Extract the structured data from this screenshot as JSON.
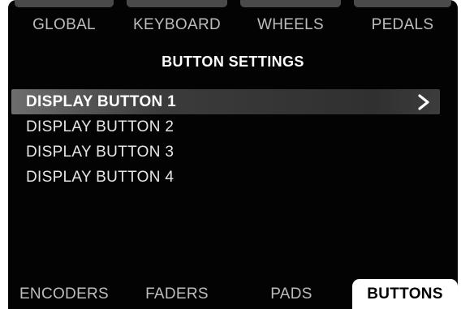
{
  "top_tabs": [
    {
      "label": "GLOBAL"
    },
    {
      "label": "KEYBOARD"
    },
    {
      "label": "WHEELS"
    },
    {
      "label": "PEDALS"
    }
  ],
  "title": "BUTTON SETTINGS",
  "list": {
    "selected_index": 0,
    "items": [
      {
        "label": "DISPLAY BUTTON 1"
      },
      {
        "label": "DISPLAY BUTTON 2"
      },
      {
        "label": "DISPLAY BUTTON 3"
      },
      {
        "label": "DISPLAY BUTTON 4"
      }
    ],
    "selected_icon": "chevron-right-icon"
  },
  "bottom_tabs": [
    {
      "label": "ENCODERS"
    },
    {
      "label": "FADERS"
    },
    {
      "label": "PADS"
    },
    {
      "label": "BUTTONS"
    }
  ],
  "active_bottom_tab": "BUTTONS",
  "colors": {
    "screen_background": "#030303",
    "text": "#e6e6e6",
    "inactive_tab_text": "#bdbdbd",
    "active_tab_background": "#ffffff",
    "active_tab_text": "#000000"
  }
}
